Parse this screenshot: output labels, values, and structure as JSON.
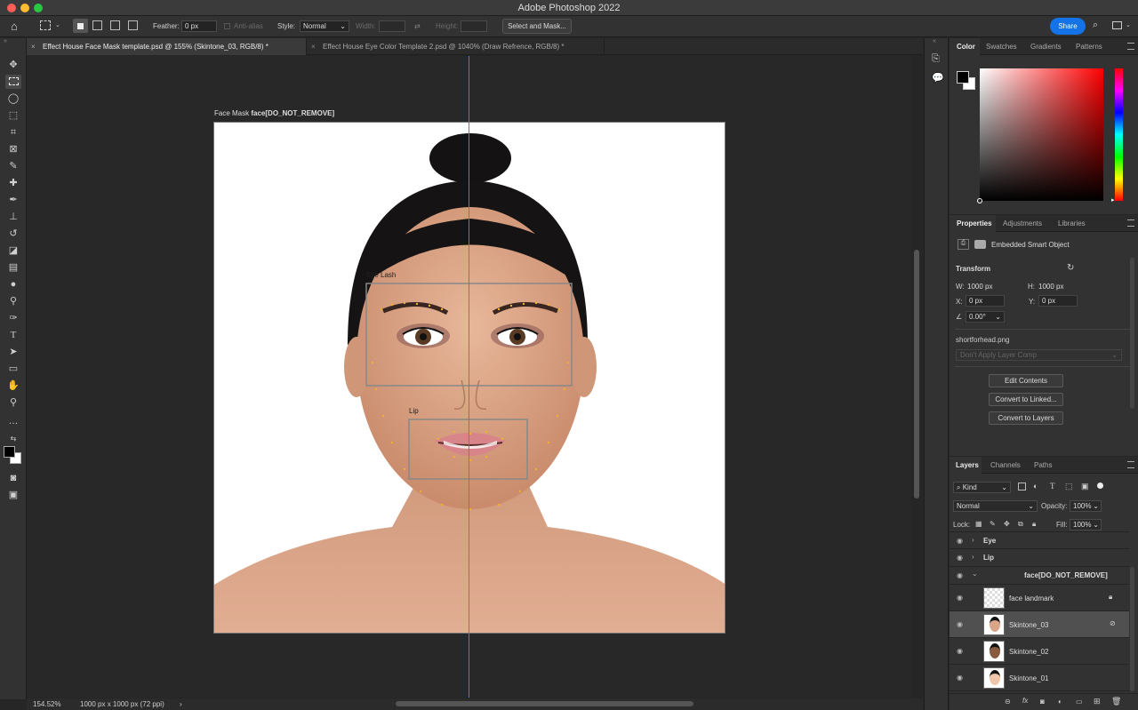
{
  "app": {
    "title": "Adobe Photoshop 2022"
  },
  "options_bar": {
    "feather_label": "Feather:",
    "feather_value": "0 px",
    "antialias_label": "Anti-alias",
    "style_label": "Style:",
    "style_value": "Normal",
    "width_label": "Width:",
    "height_label": "Height:",
    "select_mask_label": "Select and Mask...",
    "share_label": "Share"
  },
  "tabs": [
    {
      "label": "Effect House Face Mask template.psd @ 155% (Skintone_03, RGB/8) *",
      "active": true
    },
    {
      "label": "Effect House Eye Color Template 2.psd @ 1040% (Draw Refrence, RGB/8) *",
      "active": false
    }
  ],
  "canvas": {
    "artboard_prefix": "Face Mask",
    "artboard_name": "face[DO_NOT_REMOVE]",
    "eye_label": "Eye Lash",
    "lip_label": "Lip"
  },
  "status": {
    "zoom": "154.52%",
    "doc_size": "1000 px x 1000 px (72 ppi)"
  },
  "color_panel": {
    "tabs": [
      "Color",
      "Swatches",
      "Gradients",
      "Patterns"
    ],
    "foreground": "#000000",
    "background": "#ffffff",
    "hue": "#ff0000"
  },
  "properties_panel": {
    "tabs": [
      "Properties",
      "Adjustments",
      "Libraries"
    ],
    "object_type": "Embedded Smart Object",
    "transform_label": "Transform",
    "w_label": "W:",
    "w_value": "1000 px",
    "h_label": "H:",
    "h_value": "1000 px",
    "x_label": "X:",
    "x_value": "0 px",
    "y_label": "Y:",
    "y_value": "0 px",
    "angle_value": "0.00°",
    "filename": "shortforhead.png",
    "layer_comp": "Don't Apply Layer Comp",
    "buttons": [
      "Edit Contents",
      "Convert to Linked...",
      "Convert to Layers"
    ]
  },
  "layers_panel": {
    "tabs": [
      "Layers",
      "Channels",
      "Paths"
    ],
    "filter_value": "Kind",
    "blend_mode": "Normal",
    "opacity_label": "Opacity:",
    "opacity_value": "100%",
    "lock_label": "Lock:",
    "fill_label": "Fill:",
    "fill_value": "100%",
    "groups": [
      {
        "name": "Eye"
      },
      {
        "name": "Lip"
      },
      {
        "name": "face[DO_NOT_REMOVE]"
      }
    ],
    "layers": [
      {
        "name": "face landmark",
        "locked": true
      },
      {
        "name": "Skintone_03",
        "selected": true
      },
      {
        "name": "Skintone_02"
      },
      {
        "name": "Skintone_01"
      }
    ]
  }
}
